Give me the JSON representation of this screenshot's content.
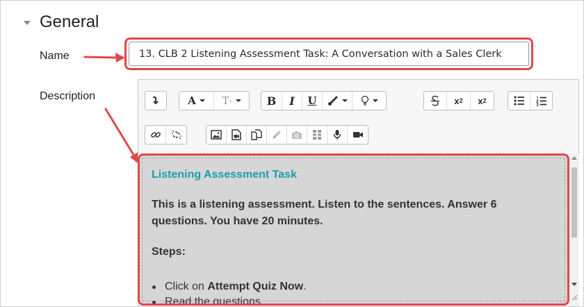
{
  "section": {
    "title": "General"
  },
  "fields": {
    "name_label": "Name",
    "name_value": "13. CLB 2 Listening Assessment Task: A Conversation with a Sales Clerk",
    "description_label": "Description"
  },
  "toolbar": {
    "font_color_label": "A",
    "font_size_label": "T",
    "bold_label": "B",
    "italic_label": "I",
    "underline_label": "U",
    "subscript_label": "x",
    "subscript_sub": "2",
    "superscript_label": "x",
    "superscript_sup": "2"
  },
  "content": {
    "heading": "Listening Assessment Task",
    "intro": "This is a listening assessment. Listen to the sentences. Answer 6 questions. You have 20 minutes.",
    "steps_label": "Steps:",
    "items": [
      {
        "before": "Click on ",
        "bold": "Attempt Quiz Now",
        "after": "."
      },
      {
        "before": "Read the questions",
        "bold": "",
        "after": ""
      }
    ]
  },
  "colors": {
    "highlight": "#e0474c",
    "heading": "#1a9fa8",
    "content_bg": "#d6d6d6"
  },
  "icons": [
    "chevron-down-icon",
    "arrow-right-icon",
    "undo-icon",
    "clean-icon",
    "link-icon",
    "unlink-icon",
    "image-icon",
    "media-icon",
    "manage-files-icon",
    "pencil-icon",
    "camera-icon",
    "qr-icon",
    "microphone-icon",
    "video-icon",
    "bullet-list-icon",
    "numbered-list-icon",
    "strikethrough-icon",
    "brush-icon",
    "lightbulb-icon"
  ]
}
